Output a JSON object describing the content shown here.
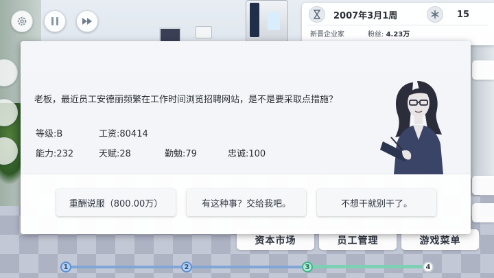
{
  "controls": {
    "settings_icon": "gear-icon",
    "pause_icon": "pause-icon",
    "fastforward_icon": "fast-forward-icon"
  },
  "info_panel": {
    "date": "2007年3月1周",
    "temperature": "15",
    "rank_label": "新晋企业家",
    "fans_label": "粉丝:",
    "fans_value": "4.23万"
  },
  "dialog": {
    "question": "老板，最近员工安德丽频繁在工作时间浏览招聘网站，是不是要采取点措施？",
    "stats": {
      "grade": "等级:B",
      "salary": "工资:80414",
      "ability": "能力:232",
      "talent": "天赋:28",
      "diligence": "勤勉:79",
      "loyalty": "忠诚:100"
    },
    "options": [
      {
        "label": "重酬说服（800.00万）"
      },
      {
        "label": "有这种事？交给我吧。"
      },
      {
        "label": "不想干就别干了。"
      }
    ]
  },
  "bottom_menu": {
    "capital_market": "资本市场",
    "staff_management": "员工管理",
    "game_menu": "游戏菜单"
  },
  "progress_steps": {
    "steps": [
      "1",
      "2",
      "3",
      "4"
    ],
    "current": 3
  },
  "colors": {
    "accent_blue": "#5d8fd0",
    "accent_green": "#41b58f"
  }
}
